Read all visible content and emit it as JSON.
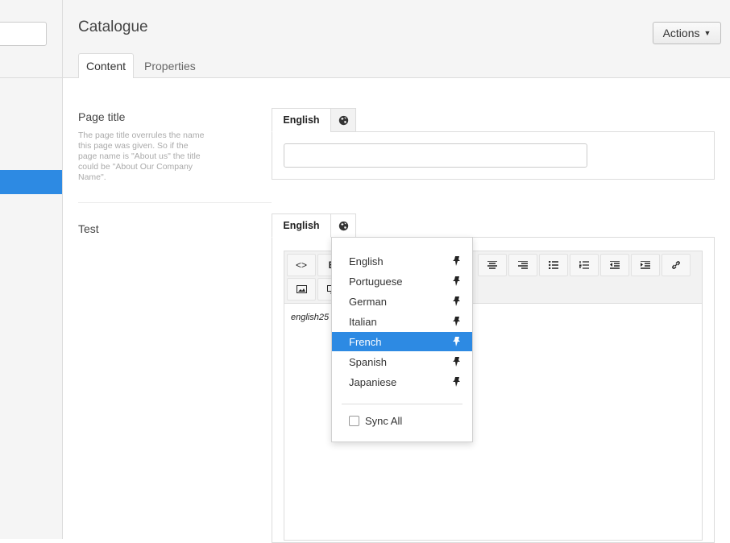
{
  "header": {
    "title": "Catalogue",
    "actions_label": "Actions"
  },
  "tabs": [
    {
      "label": "Content"
    },
    {
      "label": "Properties"
    }
  ],
  "fields": {
    "page_title": {
      "label": "Page title",
      "help": "The page title overrules the name this page was given. So if the page name is \"About us\" the title could be \"About Our Company Name\".",
      "lang_tab": "English"
    },
    "test": {
      "label": "Test",
      "lang_tab": "English",
      "editor_text": "english25"
    }
  },
  "language_menu": {
    "items": [
      {
        "label": "English"
      },
      {
        "label": "Portuguese"
      },
      {
        "label": "German"
      },
      {
        "label": "Italian"
      },
      {
        "label": "French",
        "selected": true
      },
      {
        "label": "Spanish"
      },
      {
        "label": "Japaniese"
      }
    ],
    "sync_label": "Sync All"
  },
  "toolbar": {
    "icons": [
      "code-view-icon",
      "bold-icon",
      "align-center-icon",
      "align-right-icon",
      "bullet-list-icon",
      "numbered-list-icon",
      "outdent-icon",
      "indent-icon",
      "link-icon",
      "image-icon",
      "media-icon"
    ]
  },
  "colors": {
    "accent": "#2d8ae3",
    "panel_bg": "#f5f5f5"
  }
}
